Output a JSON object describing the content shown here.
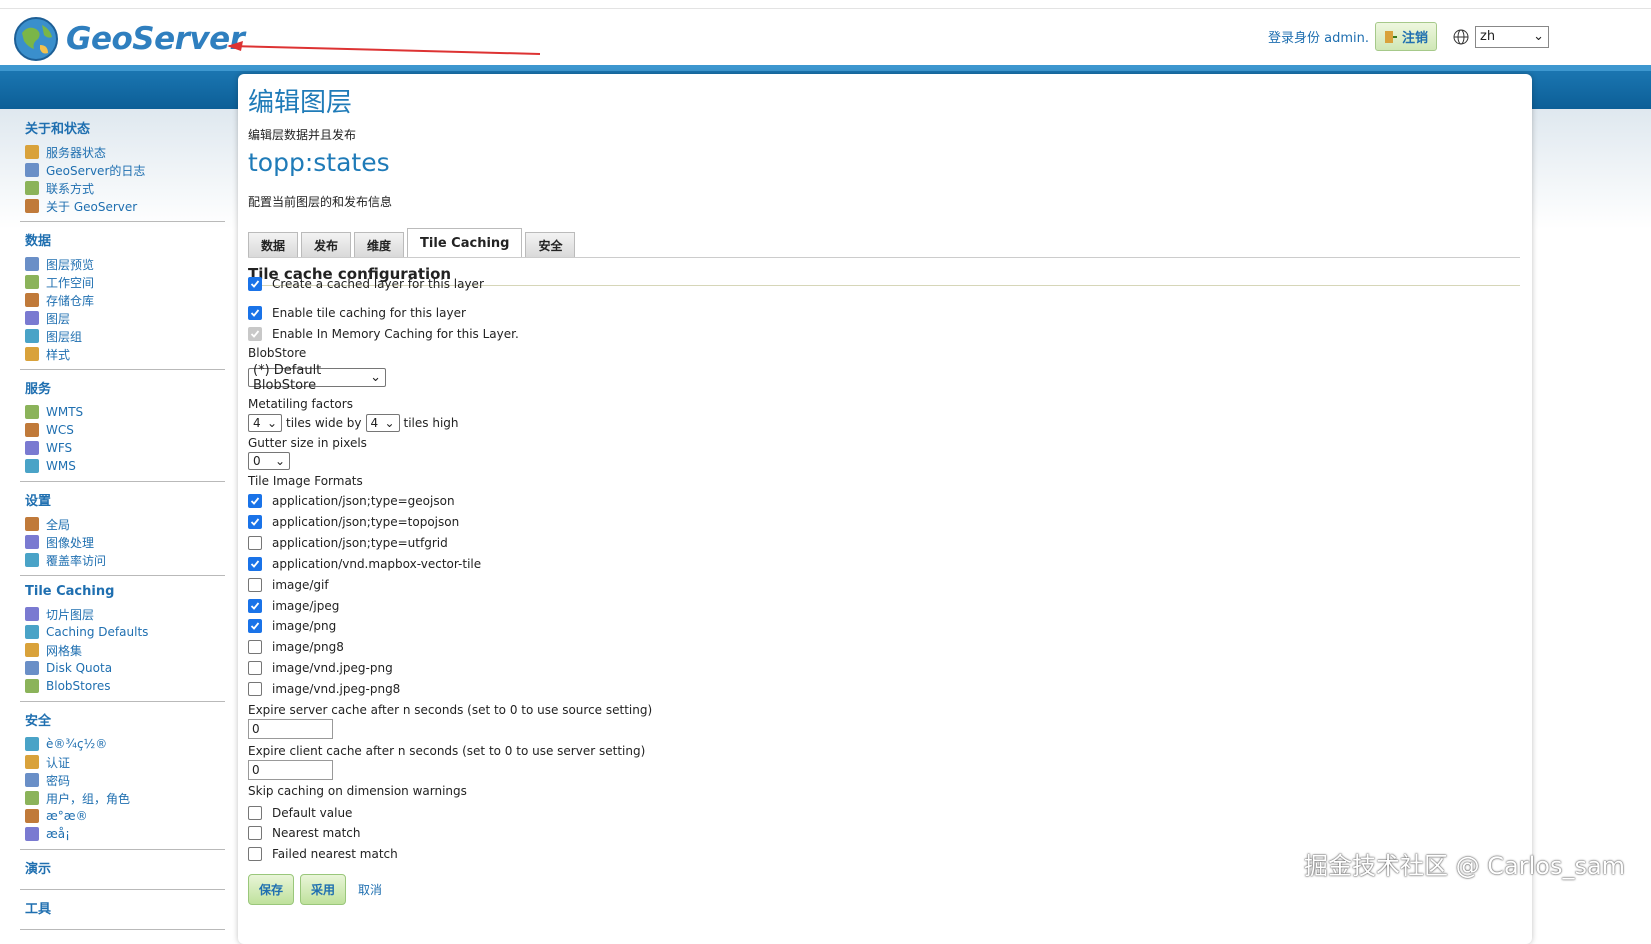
{
  "header": {
    "logo_text": "GeoServer",
    "login_text": "登录身份 admin.",
    "logout_label": "注销",
    "language": "zh"
  },
  "sidebar": {
    "sections": [
      {
        "title": "关于和状态",
        "items": [
          "服务器状态",
          "GeoServer的日志",
          "联系方式",
          "关于 GeoServer"
        ]
      },
      {
        "title": "数据",
        "items": [
          "图层预览",
          "工作空间",
          "存储仓库",
          "图层",
          "图层组",
          "样式"
        ]
      },
      {
        "title": "服务",
        "items": [
          "WMTS",
          "WCS",
          "WFS",
          "WMS"
        ]
      },
      {
        "title": "设置",
        "items": [
          "全局",
          "图像处理",
          "覆盖率访问"
        ]
      },
      {
        "title": "Tile Caching",
        "items": [
          "切片图层",
          "Caching Defaults",
          "网格集",
          "Disk Quota",
          "BlobStores"
        ]
      },
      {
        "title": "安全",
        "items": [
          "è®¾ç½®",
          "认证",
          "密码",
          "用户，组，角色",
          "æ°æ®",
          "æå¡"
        ]
      },
      {
        "title": "演示",
        "items": []
      },
      {
        "title": "工具",
        "items": []
      }
    ]
  },
  "page": {
    "title": "编辑图层",
    "subtitle": "编辑层数据并且发布",
    "layer_name": "topp:states",
    "layer_desc": "配置当前图层的和发布信息",
    "tabs": [
      "数据",
      "发布",
      "维度",
      "Tile Caching",
      "安全"
    ],
    "active_tab": "Tile Caching"
  },
  "form": {
    "section_title": "Tile cache configuration",
    "create_cached": "Create a cached layer for this layer",
    "enable_tile_caching": "Enable tile caching for this layer",
    "enable_memory": "Enable In Memory Caching for this Layer.",
    "blobstore_label": "BlobStore",
    "blobstore_value": "(*) Default BlobStore",
    "metatiling_label": "Metatiling factors",
    "meta_wide": "4",
    "tiles_wide_by": "tiles wide by",
    "meta_high": "4",
    "tiles_high": "tiles high",
    "gutter_label": "Gutter size in pixels",
    "gutter_value": "0",
    "formats_label": "Tile Image Formats",
    "formats": [
      {
        "name": "application/json;type=geojson",
        "checked": true
      },
      {
        "name": "application/json;type=topojson",
        "checked": true
      },
      {
        "name": "application/json;type=utfgrid",
        "checked": false
      },
      {
        "name": "application/vnd.mapbox-vector-tile",
        "checked": true
      },
      {
        "name": "image/gif",
        "checked": false
      },
      {
        "name": "image/jpeg",
        "checked": true
      },
      {
        "name": "image/png",
        "checked": true
      },
      {
        "name": "image/png8",
        "checked": false
      },
      {
        "name": "image/vnd.jpeg-png",
        "checked": false
      },
      {
        "name": "image/vnd.jpeg-png8",
        "checked": false
      }
    ],
    "expire_server_label": "Expire server cache after n seconds (set to 0 to use source setting)",
    "expire_server_value": "0",
    "expire_client_label": "Expire client cache after n seconds (set to 0 to use server setting)",
    "expire_client_value": "0",
    "skip_label": "Skip caching on dimension warnings",
    "skip_options": [
      "Default value",
      "Nearest match",
      "Failed nearest match"
    ]
  },
  "buttons": {
    "save": "保存",
    "apply": "采用",
    "cancel": "取消"
  },
  "watermark": "掘金技术社区 @ Carlos_sam"
}
